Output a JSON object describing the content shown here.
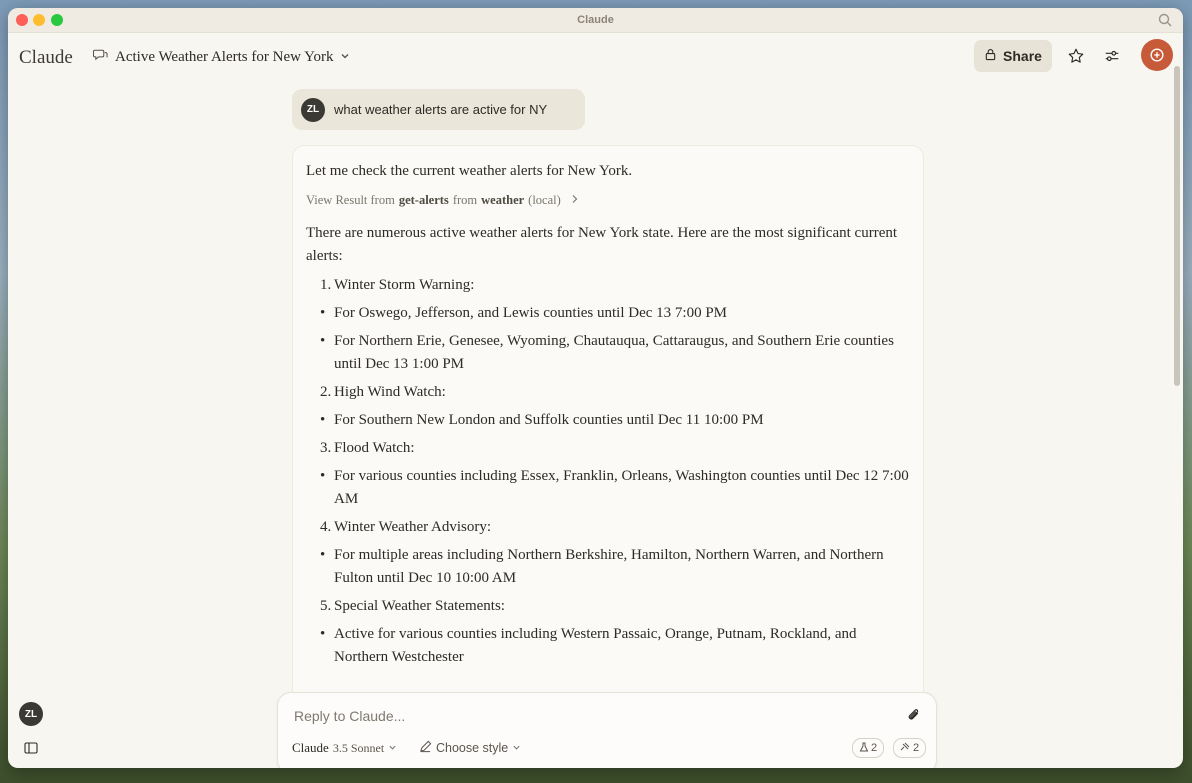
{
  "window": {
    "title": "Claude"
  },
  "header": {
    "brand": "Claude",
    "chat_title": "Active Weather Alerts for New York",
    "share_label": "Share"
  },
  "user": {
    "initials": "ZL",
    "message": "what weather alerts are active for NY"
  },
  "assistant": {
    "intro": "Let me check the current weather alerts for New York.",
    "tool": {
      "prefix": "View Result from",
      "tool_name": "get-alerts",
      "middle": "from",
      "server": "weather",
      "suffix": "(local)"
    },
    "summary": "There are numerous active weather alerts for New York state. Here are the most significant current alerts:",
    "items": [
      {
        "marker": "1.",
        "text": "Winter Storm Warning:",
        "kind": "num"
      },
      {
        "marker": "•",
        "text": "For Oswego, Jefferson, and Lewis counties until Dec 13 7:00 PM",
        "kind": "bullet"
      },
      {
        "marker": "•",
        "text": "For Northern Erie, Genesee, Wyoming, Chautauqua, Cattaraugus, and Southern Erie counties until Dec 13 1:00 PM",
        "kind": "bullet"
      },
      {
        "marker": "2.",
        "text": "High Wind Watch:",
        "kind": "num"
      },
      {
        "marker": "•",
        "text": "For Southern New London and Suffolk counties until Dec 11 10:00 PM",
        "kind": "bullet"
      },
      {
        "marker": "3.",
        "text": "Flood Watch:",
        "kind": "num"
      },
      {
        "marker": "•",
        "text": "For various counties including Essex, Franklin, Orleans, Washington counties until Dec 12 7:00 AM",
        "kind": "bullet"
      },
      {
        "marker": "4.",
        "text": "Winter Weather Advisory:",
        "kind": "num"
      },
      {
        "marker": "•",
        "text": "For multiple areas including Northern Berkshire, Hamilton, Northern Warren, and Northern Fulton until Dec 10 10:00 AM",
        "kind": "bullet"
      },
      {
        "marker": "5.",
        "text": "Special Weather Statements:",
        "kind": "num"
      },
      {
        "marker": "•",
        "text": "Active for various counties including Western Passaic, Orange, Putnam, Rockland, and Northern Westchester",
        "kind": "bullet"
      }
    ]
  },
  "composer": {
    "placeholder": "Reply to Claude...",
    "model_name": "Claude",
    "model_version": "3.5 Sonnet",
    "style_label": "Choose style",
    "pill1_count": "2",
    "pill2_count": "2"
  },
  "sidebar": {
    "initials": "ZL"
  },
  "colors": {
    "accent": "#c75b39",
    "avatar": "#3b3934"
  }
}
